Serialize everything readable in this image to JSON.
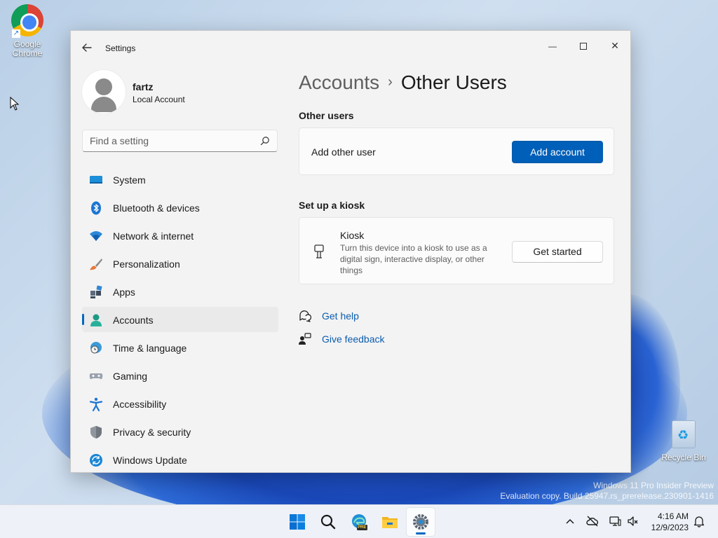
{
  "desktop": {
    "icons": [
      {
        "label_line1": "Google",
        "label_line2": "Chrome"
      },
      {
        "label_line1": "Recycle Bin"
      }
    ],
    "watermark": {
      "line1": "Windows 11 Pro Insider Preview",
      "line2": "Evaluation copy. Build 25947.rs_prerelease.230901-1416"
    }
  },
  "window": {
    "title": "Settings",
    "controls": {
      "minimize": "—",
      "close": "✕"
    }
  },
  "profile": {
    "name": "fartz",
    "account_type": "Local Account"
  },
  "search": {
    "placeholder": "Find a setting",
    "icon": "search-icon"
  },
  "sidebar": {
    "items": [
      {
        "label": "System",
        "icon": "system-icon"
      },
      {
        "label": "Bluetooth & devices",
        "icon": "bluetooth-icon"
      },
      {
        "label": "Network & internet",
        "icon": "wifi-icon"
      },
      {
        "label": "Personalization",
        "icon": "brush-icon"
      },
      {
        "label": "Apps",
        "icon": "apps-icon"
      },
      {
        "label": "Accounts",
        "icon": "accounts-icon",
        "selected": true
      },
      {
        "label": "Time & language",
        "icon": "globe-clock-icon"
      },
      {
        "label": "Gaming",
        "icon": "gamepad-icon"
      },
      {
        "label": "Accessibility",
        "icon": "accessibility-icon"
      },
      {
        "label": "Privacy & security",
        "icon": "shield-icon"
      },
      {
        "label": "Windows Update",
        "icon": "update-icon"
      }
    ]
  },
  "main": {
    "breadcrumb": {
      "parent": "Accounts",
      "separator": "›",
      "current": "Other Users"
    },
    "other_users": {
      "section_title": "Other users",
      "row_label": "Add other user",
      "button_label": "Add account"
    },
    "kiosk": {
      "section_title": "Set up a kiosk",
      "title": "Kiosk",
      "description": "Turn this device into a kiosk to use as a digital sign, interactive display, or other things",
      "button_label": "Get started"
    },
    "links": [
      {
        "label": "Get help",
        "icon": "help-chat-icon"
      },
      {
        "label": "Give feedback",
        "icon": "feedback-icon"
      }
    ]
  },
  "taskbar": {
    "apps": [
      "start-icon",
      "search-icon",
      "edge-pre-icon",
      "file-explorer-icon",
      "settings-icon"
    ],
    "edge_badge": "PRE",
    "tray": [
      "chevron-up-icon",
      "cloud-off-icon",
      "network-icon",
      "volume-muted-icon"
    ],
    "time": "4:16 AM",
    "date": "12/9/2023"
  },
  "colors": {
    "accent": "#005fb8",
    "link": "#0b5cad",
    "window_bg": "#f3f3f3",
    "card_bg": "#fbfbfb"
  }
}
